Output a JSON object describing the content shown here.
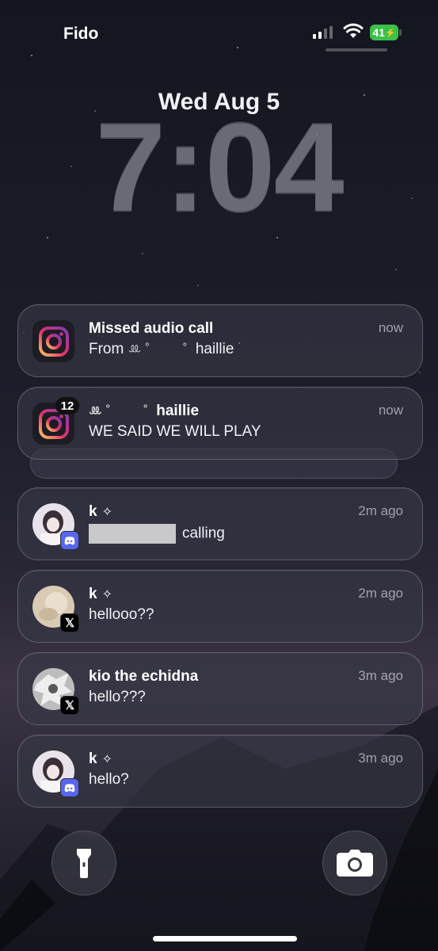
{
  "status_bar": {
    "carrier": "Fido",
    "battery": "41"
  },
  "lockscreen": {
    "date": "Wed Aug 5",
    "time": "7:04"
  },
  "notifications": [
    {
      "app": "instagram",
      "title": "Missed audio call",
      "body_prefix": "From",
      "name": "haillie",
      "time": "now"
    },
    {
      "app": "instagram",
      "badge": "12",
      "name": "haillie",
      "body": "WE SAID WE WILL PLAY",
      "time": "now"
    },
    {
      "app": "discord",
      "title": "k",
      "body": "calling",
      "time": "2m ago"
    },
    {
      "app": "x",
      "title": "k",
      "body": "hellooo??",
      "time": "2m ago"
    },
    {
      "app": "x",
      "title": "kio the echidna",
      "body": "hello???",
      "time": "3m ago"
    },
    {
      "app": "discord",
      "title": "k",
      "body": "hello?",
      "time": "3m ago"
    }
  ],
  "icons": {
    "sparkle": "✧",
    "x_logo": "𝕏",
    "flashlight": "flashlight-icon",
    "camera": "camera-icon",
    "instagram": "instagram-icon",
    "discord": "discord-icon"
  },
  "colors": {
    "battery": "#3cc04a",
    "discord": "#5865f2"
  }
}
